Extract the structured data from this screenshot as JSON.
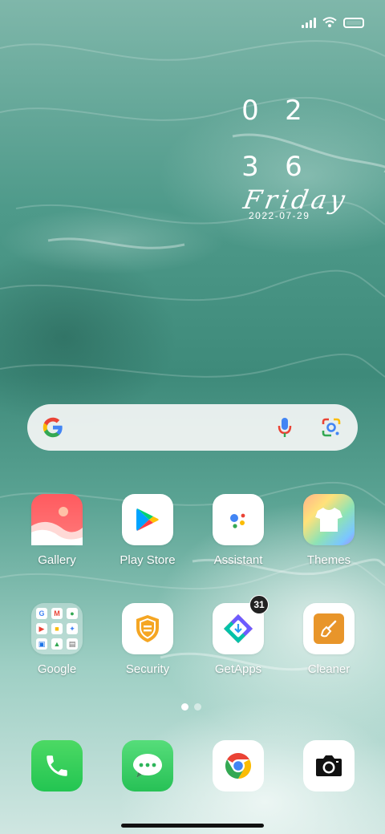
{
  "status_bar": {
    "signal_icon": "signal-icon",
    "wifi_icon": "wifi-icon",
    "battery_icon": "battery-icon"
  },
  "clock_widget": {
    "hour_digits": [
      "0",
      "2"
    ],
    "minute_digits": [
      "3",
      "6"
    ],
    "weekday": "Friday",
    "date": "2022-07-29"
  },
  "search_bar": {
    "logo_icon": "google-g-icon",
    "mic_icon": "microphone-icon",
    "lens_icon": "google-lens-icon"
  },
  "apps_row1": [
    {
      "label": "Gallery",
      "icon": "gallery-icon"
    },
    {
      "label": "Play Store",
      "icon": "play-store-icon"
    },
    {
      "label": "Assistant",
      "icon": "assistant-icon"
    },
    {
      "label": "Themes",
      "icon": "themes-icon"
    }
  ],
  "apps_row2": [
    {
      "label": "Google",
      "icon": "google-folder-icon"
    },
    {
      "label": "Security",
      "icon": "security-shield-icon"
    },
    {
      "label": "GetApps",
      "icon": "getapps-icon",
      "badge": "31"
    },
    {
      "label": "Cleaner",
      "icon": "cleaner-brush-icon"
    }
  ],
  "page_indicator": {
    "pages": 2,
    "current": 1
  },
  "dock": [
    {
      "icon": "phone-icon"
    },
    {
      "icon": "messages-icon"
    },
    {
      "icon": "chrome-icon"
    },
    {
      "icon": "camera-icon"
    }
  ],
  "colors": {
    "phone_green": "#2ecc5a",
    "messages_green": "#3ccf6a",
    "google_blue": "#4285f4",
    "google_red": "#ea4335",
    "google_yellow": "#fbbc05",
    "google_green": "#34a853",
    "security_orange": "#f5a623",
    "cleaner_orange": "#e8952a"
  }
}
